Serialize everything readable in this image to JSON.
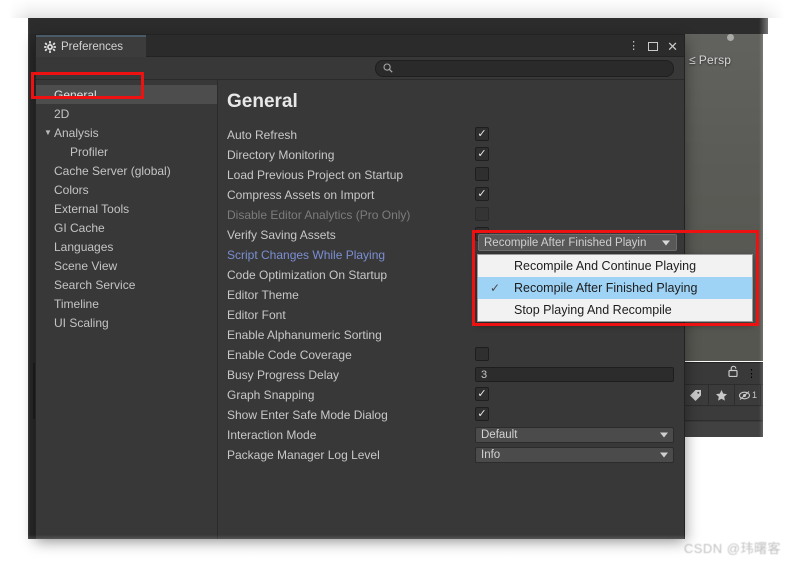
{
  "window": {
    "tab_label": "Preferences",
    "gear_icon": "gear-icon",
    "controls": {
      "menu": "⋮",
      "maximize": "maximize-icon",
      "close": "✕"
    }
  },
  "search": {
    "value": "",
    "placeholder": "",
    "icon": "search-icon"
  },
  "sidebar": {
    "items": [
      {
        "label": "General",
        "selected": true,
        "indent": 0,
        "arrow": ""
      },
      {
        "label": "2D",
        "selected": false,
        "indent": 0,
        "arrow": ""
      },
      {
        "label": "Analysis",
        "selected": false,
        "indent": 0,
        "arrow": "▼"
      },
      {
        "label": "Profiler",
        "selected": false,
        "indent": 1,
        "arrow": ""
      },
      {
        "label": "Cache Server (global)",
        "selected": false,
        "indent": 0,
        "arrow": ""
      },
      {
        "label": "Colors",
        "selected": false,
        "indent": 0,
        "arrow": ""
      },
      {
        "label": "External Tools",
        "selected": false,
        "indent": 0,
        "arrow": ""
      },
      {
        "label": "GI Cache",
        "selected": false,
        "indent": 0,
        "arrow": ""
      },
      {
        "label": "Languages",
        "selected": false,
        "indent": 0,
        "arrow": ""
      },
      {
        "label": "Scene View",
        "selected": false,
        "indent": 0,
        "arrow": ""
      },
      {
        "label": "Search Service",
        "selected": false,
        "indent": 0,
        "arrow": ""
      },
      {
        "label": "Timeline",
        "selected": false,
        "indent": 0,
        "arrow": ""
      },
      {
        "label": "UI Scaling",
        "selected": false,
        "indent": 0,
        "arrow": ""
      }
    ]
  },
  "content": {
    "title": "General",
    "rows": [
      {
        "label": "Auto Refresh",
        "type": "checkbox",
        "value": true,
        "state": "normal"
      },
      {
        "label": "Directory Monitoring",
        "type": "checkbox",
        "value": true,
        "state": "normal"
      },
      {
        "label": "Load Previous Project on Startup",
        "type": "checkbox",
        "value": false,
        "state": "normal"
      },
      {
        "label": "Compress Assets on Import",
        "type": "checkbox",
        "value": true,
        "state": "normal"
      },
      {
        "label": "Disable Editor Analytics (Pro Only)",
        "type": "checkbox",
        "value": false,
        "state": "disabled"
      },
      {
        "label": "Verify Saving Assets",
        "type": "checkbox",
        "value": false,
        "state": "normal"
      },
      {
        "label": "Script Changes While Playing",
        "type": "hidden",
        "value": "",
        "state": "link"
      },
      {
        "label": "Code Optimization On Startup",
        "type": "hidden",
        "value": "",
        "state": "normal"
      },
      {
        "label": "Editor Theme",
        "type": "hidden",
        "value": "",
        "state": "normal"
      },
      {
        "label": "Editor Font",
        "type": "hidden",
        "value": "",
        "state": "normal"
      },
      {
        "label": "Enable Alphanumeric Sorting",
        "type": "hidden",
        "value": "",
        "state": "normal"
      },
      {
        "label": "Enable Code Coverage",
        "type": "checkbox",
        "value": false,
        "state": "normal"
      },
      {
        "label": "Busy Progress Delay",
        "type": "text",
        "value": "3",
        "state": "normal"
      },
      {
        "label": "Graph Snapping",
        "type": "checkbox",
        "value": true,
        "state": "normal"
      },
      {
        "label": "Show Enter Safe Mode Dialog",
        "type": "checkbox",
        "value": true,
        "state": "normal"
      },
      {
        "label": "Interaction Mode",
        "type": "dropdown",
        "value": "Default",
        "state": "normal"
      },
      {
        "label": "Package Manager Log Level",
        "type": "dropdown",
        "value": "Info",
        "state": "normal"
      }
    ]
  },
  "dropdown_popup": {
    "button_label": "Recompile After Finished Playin",
    "options": [
      {
        "label": "Recompile And Continue Playing",
        "selected": false
      },
      {
        "label": "Recompile After Finished Playing",
        "selected": true
      },
      {
        "label": "Stop Playing And Recompile",
        "selected": false
      }
    ],
    "check_glyph": "✓"
  },
  "scene_view": {
    "perspective_label": "Persp",
    "arrow_glyph": "≤"
  },
  "inspector": {
    "lock_icon": "lock-open-icon",
    "menu_icon": "⋮",
    "buttons": [
      "tag-icon",
      "star-icon",
      "visibility-off-icon"
    ],
    "count_label": "1"
  },
  "watermark": {
    "text": "CSDN @玮曙客"
  },
  "colors": {
    "accent_blue": "#9fd3f5",
    "link_blue": "#7b8fd2",
    "annotation_red": "#ee1111",
    "panel_bg": "#383838"
  }
}
